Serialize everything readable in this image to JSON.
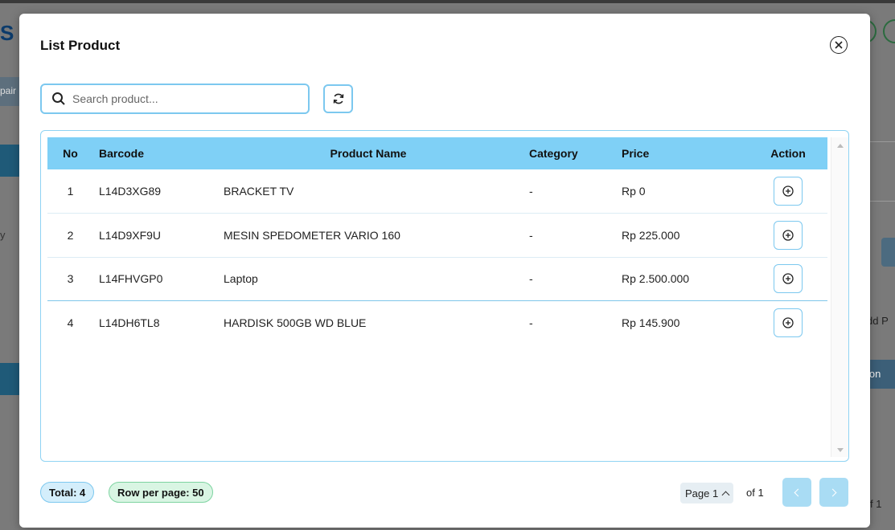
{
  "modal": {
    "title": "List Product",
    "search": {
      "placeholder": "Search product...",
      "value": ""
    },
    "icons": {
      "search": "search-icon",
      "refresh": "refresh-icon",
      "close": "close-icon",
      "add": "plus-circle-icon"
    }
  },
  "table": {
    "headers": {
      "no": "No",
      "barcode": "Barcode",
      "name": "Product Name",
      "category": "Category",
      "price": "Price",
      "action": "Action"
    },
    "rows": [
      {
        "no": "1",
        "barcode": "L14D3XG89",
        "name": "BRACKET TV",
        "category": "-",
        "price": "Rp 0"
      },
      {
        "no": "2",
        "barcode": "L14D9XF9U",
        "name": "MESIN SPEDOMETER VARIO 160",
        "category": "-",
        "price": "Rp 225.000"
      },
      {
        "no": "3",
        "barcode": "L14FHVGP0",
        "name": "Laptop",
        "category": "-",
        "price": "Rp 2.500.000"
      },
      {
        "no": "4",
        "barcode": "L14DH6TL8",
        "name": "HARDISK 500GB WD BLUE",
        "category": "-",
        "price": "Rp 145.900"
      }
    ]
  },
  "footer": {
    "total": "Total: 4",
    "rows_per_page": "Row per page: 50",
    "page_label": "Page 1",
    "of_label": "of 1"
  },
  "background": {
    "left_logo": "S",
    "left_tab": "pair",
    "left_text": "y",
    "right_text_1": "dd P",
    "right_text_2": "ion",
    "right_text_3": "f 1"
  },
  "colors": {
    "accent": "#7fd0f6",
    "header_bg": "#7fd0f6",
    "border": "#7cc8ef",
    "rows_pill": "#d9f5e3"
  }
}
